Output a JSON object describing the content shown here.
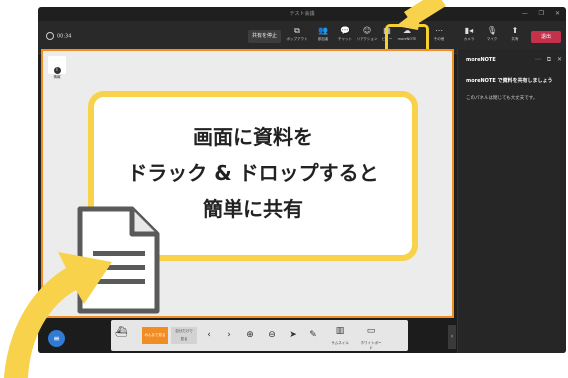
{
  "window": {
    "title": "テスト会議",
    "controls": [
      "—",
      "❐",
      "✕"
    ]
  },
  "toolbar": {
    "timer": "00:34",
    "stop_share": "共有を停止",
    "buttons": [
      {
        "name": "popout",
        "icon": "⧉",
        "label": "ポップアウト"
      },
      {
        "name": "people",
        "icon": "👥",
        "label": "参加者"
      },
      {
        "name": "chat",
        "icon": "💬",
        "label": "チャット"
      },
      {
        "name": "react",
        "icon": "☺",
        "label": "リアクション"
      },
      {
        "name": "view",
        "icon": "▦",
        "label": "ビュー"
      },
      {
        "name": "morenote",
        "icon": "☁",
        "label": "moreNOTE"
      },
      {
        "name": "more",
        "icon": "⋯",
        "label": "その他"
      },
      {
        "name": "camera",
        "icon": "▮◂",
        "label": "カメラ"
      },
      {
        "name": "mic",
        "icon": "🎙",
        "label": "マイク"
      },
      {
        "name": "share",
        "icon": "⬆",
        "label": "共有"
      }
    ],
    "leave": "退出"
  },
  "stage": {
    "info_label": "情報",
    "callout": [
      "画面に資料を",
      "ドラック & ドロップすると",
      "簡単に共有"
    ]
  },
  "bottom": {
    "menu_icon": "≡",
    "orange_label": "みんなで見る",
    "grey_label": [
      "自分だけで",
      "見る"
    ],
    "nav": [
      "‹",
      "›",
      "⊕",
      "⊖",
      "➤",
      "✎"
    ],
    "thumbnail_label": "サムネイル",
    "whiteboard_label": "ホワイトボード",
    "collapse": "‹"
  },
  "sidepanel": {
    "title": "moreNOTE",
    "heading": "moreNOTE で資料を共有しましょう",
    "sub": "このパネルは閉じても大丈夫です。"
  },
  "colors": {
    "accent": "#f28c24",
    "highlight": "#f7d24a",
    "leave": "#c4314b"
  }
}
